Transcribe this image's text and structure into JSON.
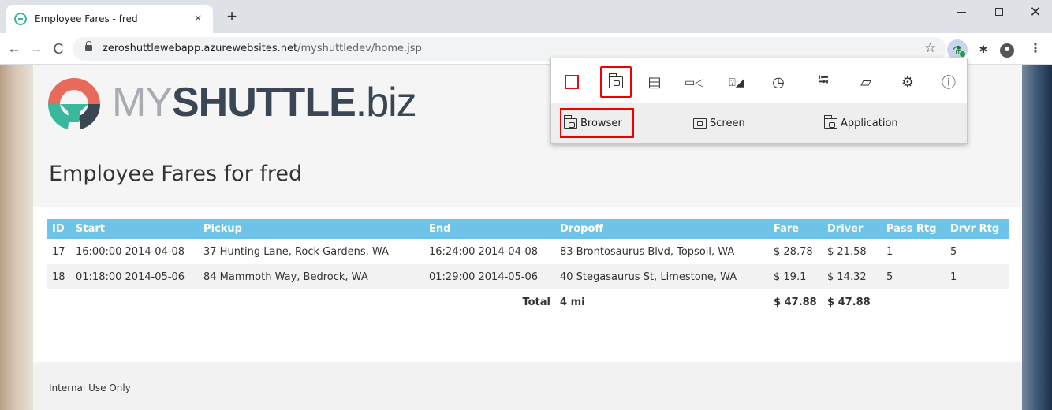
{
  "browser": {
    "tab_title": "Employee Fares - fred",
    "tab_close": "×",
    "new_tab": "+",
    "url_host": "zeroshuttlewebapp.azurewebsites.net",
    "url_path": "/myshuttledev/home.jsp",
    "back": "←",
    "forward": "→",
    "reload": "C",
    "star": "☆",
    "menu": "⋮",
    "window_close": "✕"
  },
  "popup": {
    "tools": [
      {
        "name": "stop-recording-icon"
      },
      {
        "name": "screenshot-icon",
        "selected": true
      },
      {
        "name": "comment-icon",
        "glyph": "▤"
      },
      {
        "name": "video-icon",
        "glyph": "▭◁"
      },
      {
        "name": "file-issue-icon",
        "glyph": "⍰◢"
      },
      {
        "name": "timer-icon",
        "glyph": "◷"
      },
      {
        "name": "crop-icon",
        "glyph": "⭾"
      },
      {
        "name": "device-icon",
        "glyph": "▱"
      },
      {
        "name": "gear-icon",
        "glyph": "⚙"
      },
      {
        "name": "info-icon",
        "glyph": "ⓘ"
      }
    ],
    "capture_tabs": {
      "browser": "Browser",
      "screen": "Screen",
      "application": "Application"
    }
  },
  "page": {
    "logo": {
      "my": "MY",
      "shuttle": "SHUTTLE",
      "biz": ".biz"
    },
    "title": "Employee Fares for fred",
    "table": {
      "headers": [
        "ID",
        "Start",
        "Pickup",
        "End",
        "Dropoff",
        "Fare",
        "Driver",
        "Pass Rtg",
        "Drvr Rtg"
      ],
      "rows": [
        [
          "17",
          "16:00:00 2014-04-08",
          "37 Hunting Lane, Rock Gardens, WA",
          "16:24:00 2014-04-08",
          "83 Brontosaurus Blvd, Topsoil, WA",
          "$ 28.78",
          "$ 21.58",
          "1",
          "5"
        ],
        [
          "18",
          "01:18:00 2014-05-06",
          "84 Mammoth Way, Bedrock, WA",
          "01:29:00 2014-05-06",
          "40 Stegasaurus St, Limestone, WA",
          "$ 19.1",
          "$ 14.32",
          "5",
          "1"
        ]
      ],
      "total": {
        "label": "Total",
        "distance": "4 mi",
        "fare": "$ 47.88",
        "driver": "$ 47.88"
      }
    },
    "footer": "Internal Use Only"
  },
  "colors": {
    "table_header": "#6dc3e8",
    "logo_teal": "#39b89d",
    "logo_coral": "#e86a5a",
    "logo_dark": "#3a4654",
    "highlight_red": "#e00000"
  }
}
